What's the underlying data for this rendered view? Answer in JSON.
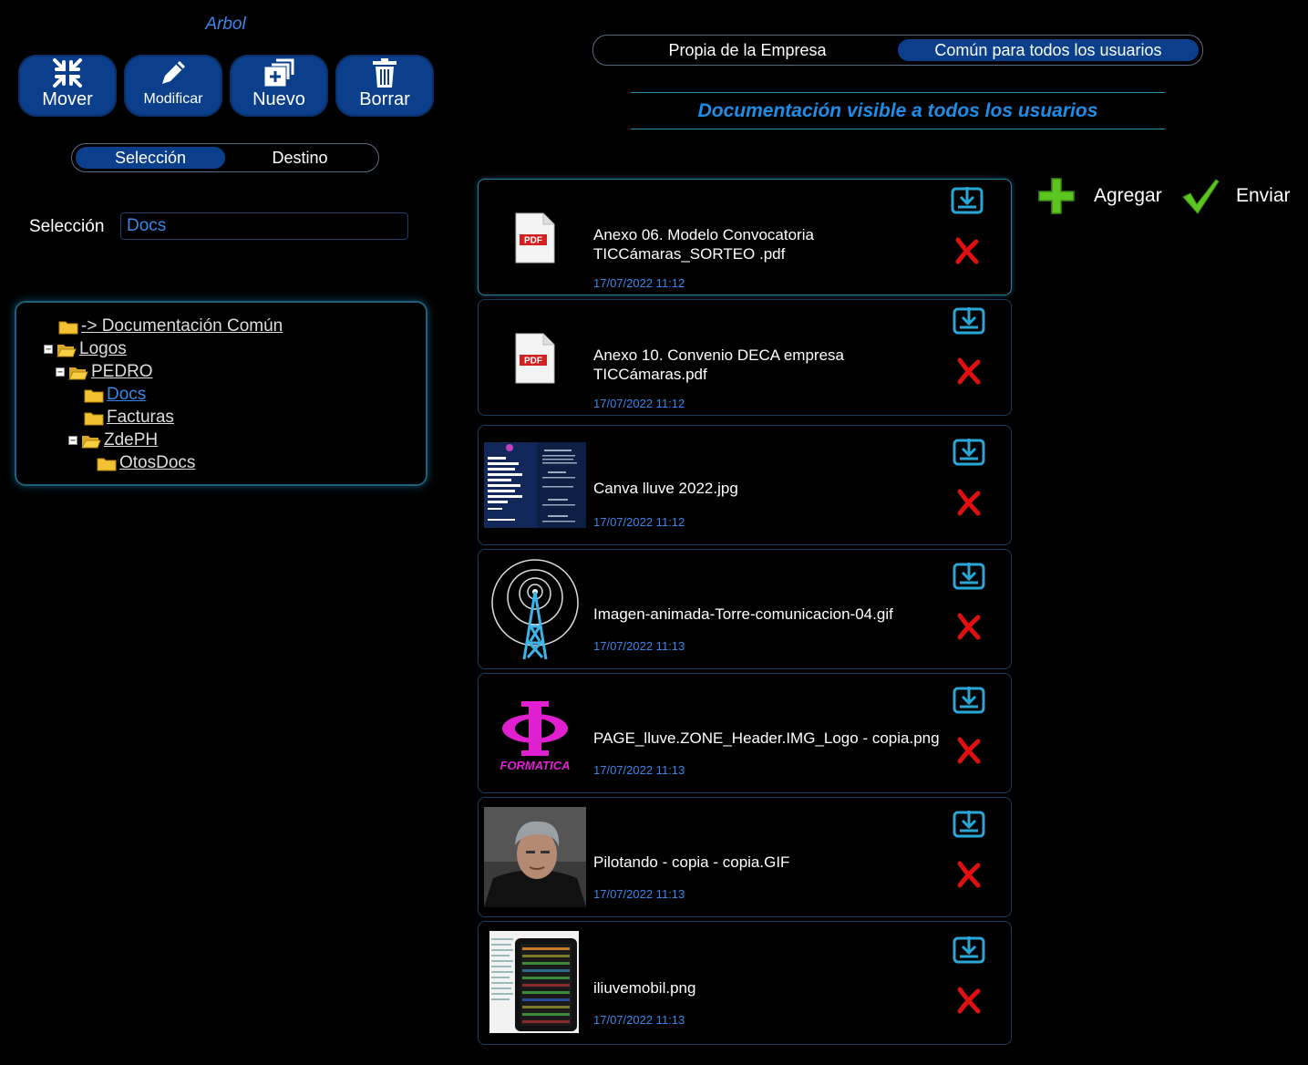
{
  "left_panel": {
    "title": "Arbol",
    "toolbar": [
      {
        "label": "Mover",
        "icon": "compress-arrows-icon"
      },
      {
        "label": "Modificar",
        "icon": "pencil-icon"
      },
      {
        "label": "Nuevo",
        "icon": "add-copy-icon"
      },
      {
        "label": "Borrar",
        "icon": "trash-icon"
      }
    ],
    "mode_toggle": {
      "options": [
        "Selección",
        "Destino"
      ],
      "active": "Selección"
    },
    "selection": {
      "label": "Selección",
      "value": "Docs"
    },
    "tree": [
      {
        "label": "-> Documentación Común",
        "expanded": null,
        "current": false
      },
      {
        "label": "Logos",
        "expanded": true,
        "current": false
      },
      {
        "label": "PEDRO",
        "expanded": true,
        "current": false
      },
      {
        "label": "Docs",
        "expanded": null,
        "current": true
      },
      {
        "label": "Facturas",
        "expanded": null,
        "current": false
      },
      {
        "label": "ZdePH",
        "expanded": true,
        "current": false
      },
      {
        "label": "OtosDocs",
        "expanded": null,
        "current": false
      }
    ]
  },
  "right_panel": {
    "scope_toggle": {
      "options": [
        "Propia de la Empresa",
        "Común para todos los usuarios"
      ],
      "active": "Común para todos los usuarios"
    },
    "header": "Documentación visible a todos los usuarios",
    "actions": {
      "add_label": "Agregar",
      "send_label": "Enviar"
    },
    "files": [
      {
        "name": "Anexo 06. Modelo Convocatoria TICCámaras_SORTEO .pdf",
        "date": "17/07/2022 11:12",
        "thumb": "pdf-file-icon"
      },
      {
        "name": "Anexo 10. Convenio DECA empresa TICCámaras.pdf",
        "date": "17/07/2022 11:12",
        "thumb": "pdf-file-icon"
      },
      {
        "name": "Canva lluve 2022.jpg",
        "date": "17/07/2022 11:12",
        "thumb": "canva-flyer-thumbnail"
      },
      {
        "name": "Imagen-animada-Torre-comunicacion-04.gif",
        "date": "17/07/2022 11:13",
        "thumb": "radio-tower-thumbnail"
      },
      {
        "name": "PAGE_lluve.ZONE_Header.IMG_Logo - copia.png",
        "date": "17/07/2022 11:13",
        "thumb": "formatica-logo-thumbnail"
      },
      {
        "name": "Pilotando - copia - copia.GIF",
        "date": "17/07/2022 11:13",
        "thumb": "person-photo-thumbnail"
      },
      {
        "name": "iliuvemobil.png",
        "date": "17/07/2022 11:13",
        "thumb": "mobile-screenshot-thumbnail"
      }
    ]
  },
  "colors": {
    "accent": "#0b3f8c",
    "link_blue": "#3a86e8",
    "header_blue": "#1e8de8",
    "delete_red": "#e01010",
    "download_cyan": "#29a8d8",
    "add_green": "#5cc520"
  }
}
